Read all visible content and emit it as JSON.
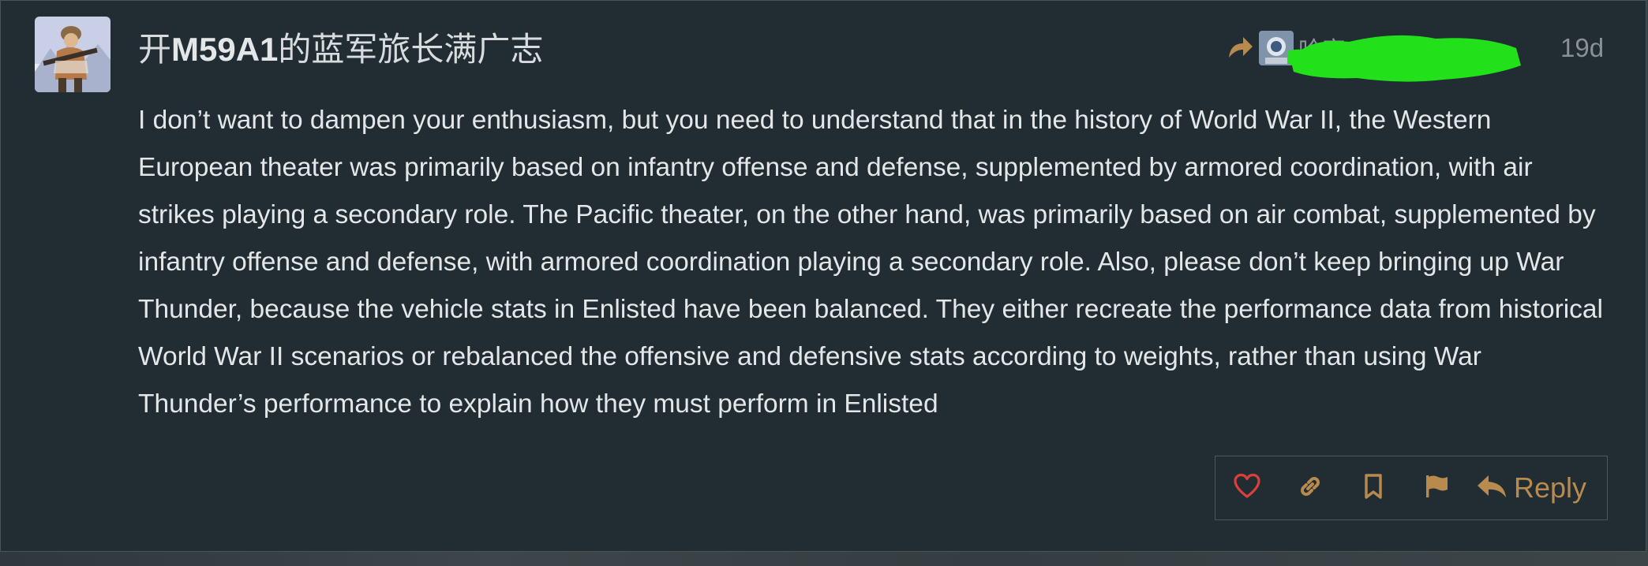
{
  "post": {
    "username_prefix": "开",
    "username_bold": "M59A1",
    "username_suffix": "的蓝军旅长满广志",
    "reply_to_name": "哈家",
    "date": "19d",
    "body": "I don’t want to dampen your enthusiasm, but you need to understand that in the history of World War II, the Western European theater was primarily based on infantry offense and defense, supplemented by armored coordination, with air strikes playing a secondary role. The Pacific theater, on the other hand, was primarily based on air combat, supplemented by infantry offense and defense, with armored coordination playing a secondary role. Also, please don’t keep bringing up War Thunder, because the vehicle stats in Enlisted have been balanced. They either recreate the performance data from historical World War II scenarios or rebalanced the offensive and defensive stats according to weights, rather than using War Thunder’s performance to explain how they must perform in Enlisted"
  },
  "actions": {
    "reply_label": "Reply"
  },
  "colors": {
    "background": "#212c33",
    "text": "#e4e7e8",
    "muted": "#8a9194",
    "accent": "#b88a4e",
    "like": "#d9403a",
    "redaction": "#22e11a"
  },
  "icons": [
    "heart-icon",
    "link-icon",
    "bookmark-icon",
    "flag-icon",
    "reply-icon",
    "share-arrow-icon"
  ]
}
